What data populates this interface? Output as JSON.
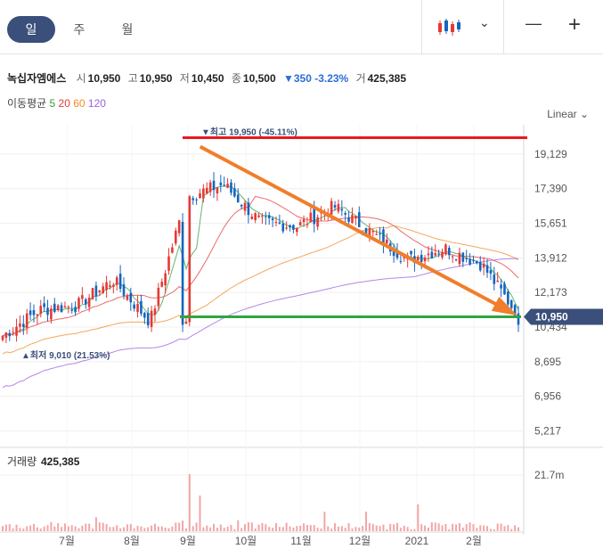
{
  "tabs": [
    {
      "label": "일",
      "active": true
    },
    {
      "label": "주",
      "active": false
    },
    {
      "label": "월",
      "active": false
    }
  ],
  "toolbar": {
    "chart_type_icon": "candlestick-icon",
    "dropdown_icon": "chevron-down-icon",
    "minimize_icon": "minus-icon",
    "add_icon": "plus-icon",
    "dropdown_glyph": "⌄",
    "minimize_glyph": "—",
    "add_glyph": "+"
  },
  "stock": {
    "name": "녹십자엠에스",
    "open_label": "시",
    "open": "10,950",
    "high_label": "고",
    "high": "10,950",
    "low_label": "저",
    "low": "10,450",
    "close_label": "종",
    "close": "10,500",
    "change": "▼350 -3.23%",
    "volume_label": "거",
    "volume": "425,385"
  },
  "moving_average": {
    "label": "이동평균",
    "periods": [
      {
        "value": "5",
        "color": "#2e9e3e"
      },
      {
        "value": "20",
        "color": "#e53935"
      },
      {
        "value": "60",
        "color": "#f08a24"
      },
      {
        "value": "120",
        "color": "#9b5fe0"
      }
    ]
  },
  "scale_label": "Linear ⌄",
  "colors": {
    "up": "#e53935",
    "down": "#1565c0",
    "accent": "#3a4f7a",
    "volume": "#f4a6a6"
  },
  "chart_data": [
    {
      "type": "candlestick",
      "title": "",
      "y_ticks": [
        "19,129",
        "17,390",
        "15,651",
        "13,912",
        "12,173",
        "10,434",
        "8,695",
        "6,956",
        "5,217"
      ],
      "y_tick_values": [
        19129,
        17390,
        15651,
        13912,
        12173,
        10434,
        8695,
        6956,
        5217
      ],
      "ylim": [
        4700,
        20600
      ],
      "x_tick_labels": [
        "7월",
        "8월",
        "9월",
        "10월",
        "11월",
        "12월",
        "2021",
        "2월"
      ],
      "current_price": "10,950",
      "current_price_value": 10950,
      "high_annotation": "▼최고 19,950 (-45.11%)",
      "high_value": 19950,
      "low_annotation": "▲최저 9,010 (21.53%)",
      "low_value": 9010,
      "price_trend_approx": [
        10000,
        11300,
        11500,
        12800,
        10700,
        17000,
        17600,
        15700,
        15500,
        16500,
        15200,
        13800,
        14400,
        13600,
        11000
      ],
      "annotations": [
        {
          "type": "resistance_line",
          "color": "#e8191d",
          "value": 19950
        },
        {
          "type": "support_line",
          "color": "#2fa540",
          "value": 10950
        },
        {
          "type": "trend_arrow",
          "color": "#f07e2b",
          "from": 19500,
          "to": 11000
        }
      ]
    },
    {
      "type": "bar",
      "title": "거래량",
      "value_label": "425,385",
      "y_ticks": [
        "21.7m"
      ],
      "y_tick_values": [
        21700000
      ]
    }
  ]
}
